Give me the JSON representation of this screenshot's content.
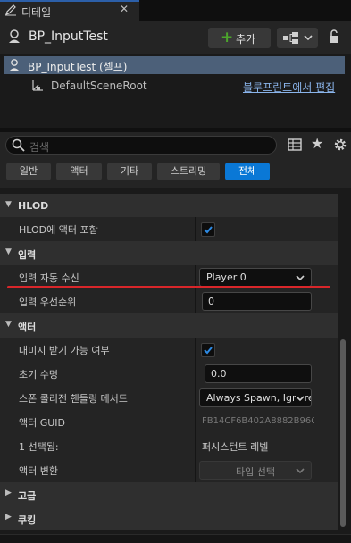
{
  "tab": {
    "title": "디테일",
    "close": "✕"
  },
  "header": {
    "title": "BP_InputTest",
    "add_label": "추가",
    "add_plus": "+"
  },
  "tree": {
    "self_label": "BP_InputTest (셀프)",
    "root_label": "DefaultSceneRoot",
    "edit_link": "블루프린트에서 편집"
  },
  "search": {
    "placeholder": "검색"
  },
  "filters": [
    "일반",
    "액터",
    "기타",
    "스트리밍",
    "전체"
  ],
  "active_filter": "전체",
  "details": {
    "hlod": {
      "category": "HLOD",
      "include_label": "HLOD에 액터 포함",
      "include_checked": true
    },
    "input": {
      "category": "입력",
      "auto_receive_label": "입력 자동 수신",
      "auto_receive_value": "Player 0",
      "priority_label": "입력 우선순위",
      "priority_value": "0"
    },
    "actor": {
      "category": "액터",
      "can_be_damaged_label": "대미지 받기 가능 여부",
      "can_be_damaged_checked": true,
      "initial_life_label": "초기 수명",
      "initial_life_value": "0.0",
      "spawn_collision_label": "스폰 콜리전 핸들링 메서드",
      "spawn_collision_value": "Always Spawn, Ignore Collisions",
      "guid_label": "액터 GUID",
      "guid_value": "FB14CF6B402A8882B96C",
      "selected_label": "1 선택됨:",
      "selected_value": "퍼시스턴트 레벨",
      "transform_label": "액터 변환",
      "transform_value": "타입 선택"
    },
    "advanced": {
      "category": "고급"
    },
    "cooking": {
      "category": "쿠킹"
    }
  },
  "colors": {
    "accent": "#0a78d6",
    "selected_row": "#4c6079",
    "add_plus": "#4ca52c",
    "annotation": "#d9262a"
  }
}
